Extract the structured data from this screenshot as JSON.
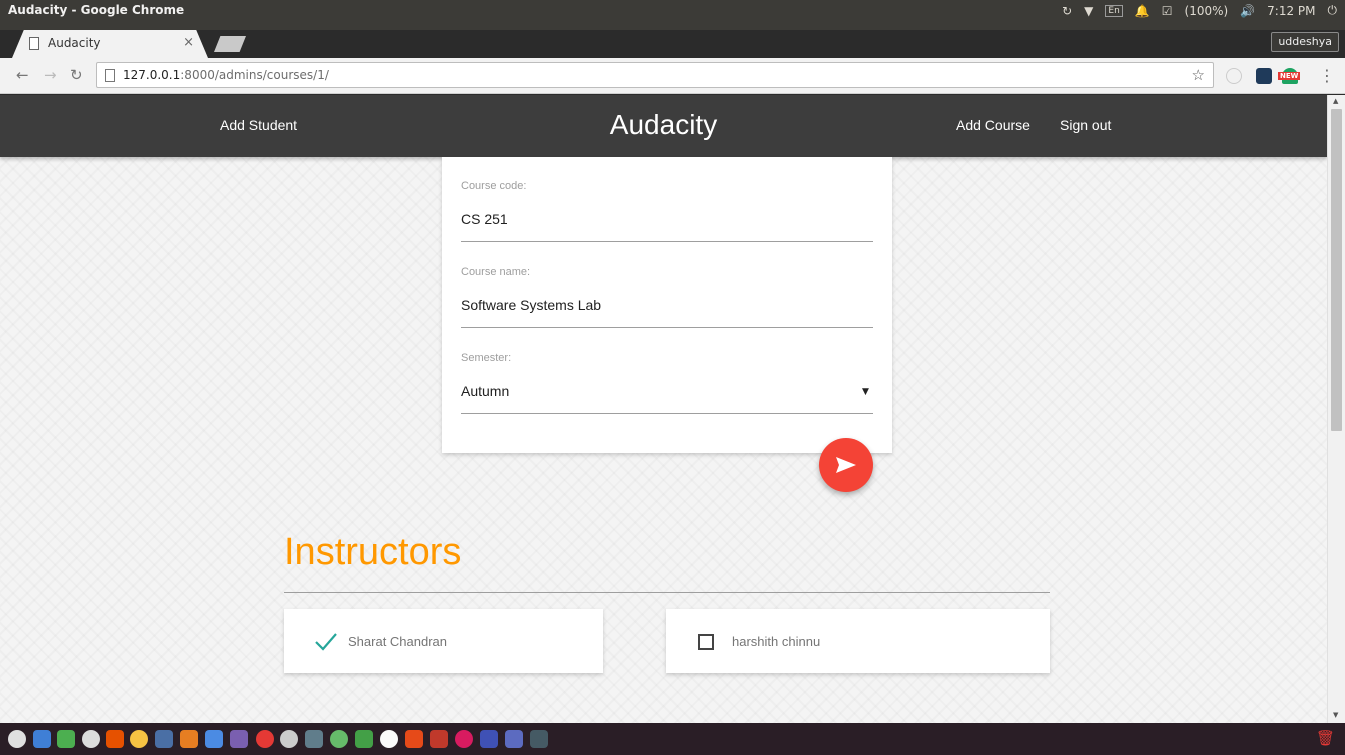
{
  "os": {
    "window_title": "Audacity - Google Chrome",
    "input_indicator": "En",
    "battery": "(100%)",
    "clock": "7:12 PM",
    "profile_name": "uddeshya"
  },
  "browser": {
    "tab_title": "Audacity",
    "tab_close": "×",
    "url_host": "127.0.0.1",
    "url_rest": ":8000/admins/courses/1/",
    "new_badge": "NEW"
  },
  "app": {
    "brand": "Audacity",
    "nav": {
      "add_student": "Add Student",
      "add_course": "Add Course",
      "sign_out": "Sign out"
    }
  },
  "form": {
    "course_code_label": "Course code:",
    "course_code_value": "CS 251",
    "course_name_label": "Course name:",
    "course_name_value": "Software Systems Lab",
    "semester_label": "Semester:",
    "semester_value": "Autumn"
  },
  "instructors": {
    "title": "Instructors",
    "items": [
      {
        "name": "Sharat Chandran",
        "checked": true
      },
      {
        "name": "harshith chinnu",
        "checked": false
      }
    ]
  },
  "colors": {
    "header_bg": "#3d3d3d",
    "accent_orange": "#ff9800",
    "fab_red": "#f44336",
    "check_teal": "#26a69a"
  }
}
